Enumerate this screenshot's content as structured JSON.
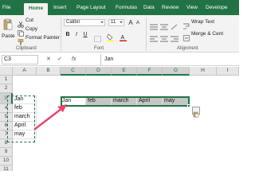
{
  "ribbon_tabs": [
    {
      "label": "File",
      "active": false
    },
    {
      "label": "Home",
      "active": true
    },
    {
      "label": "Insert",
      "active": false
    },
    {
      "label": "Page Layout",
      "active": false
    },
    {
      "label": "Formulas",
      "active": false
    },
    {
      "label": "Data",
      "active": false
    },
    {
      "label": "Review",
      "active": false
    },
    {
      "label": "View",
      "active": false
    },
    {
      "label": "Develope",
      "active": false
    }
  ],
  "clipboard": {
    "paste_label": "Paste",
    "cut_label": "Cut",
    "copy_label": "Copy",
    "format_painter_label": "Format Painter",
    "group_label": "Clipboard"
  },
  "font": {
    "family": "Calibri",
    "size": "11",
    "grow_label": "A",
    "shrink_label": "A",
    "bold_label": "B",
    "italic_label": "I",
    "underline_label": "U",
    "group_label": "Font"
  },
  "alignment": {
    "wrap_text_label": "Wrap Text",
    "merge_center_label": "Merge & Cent",
    "group_label": "Alignment"
  },
  "formula_bar": {
    "name_box": "C3",
    "fx_label": "fx",
    "content": "Jan"
  },
  "sheet": {
    "columns": [
      "A",
      "B",
      "C",
      "D",
      "E",
      "F",
      "G",
      "H",
      "I"
    ],
    "rows": [
      "1",
      "2",
      "3",
      "4",
      "5",
      "6",
      "7",
      "8",
      "9",
      "10",
      "11"
    ],
    "column_a_values": [
      "Jan",
      "feb",
      "march",
      "April",
      "may"
    ],
    "row3_values": [
      "Jan",
      "feb",
      "march",
      "April",
      "may"
    ],
    "selected_cell": "C3",
    "selected_range": "C3:G3",
    "copied_range": "A3:A7"
  },
  "colors": {
    "brand": "#217346",
    "arrow": "#e8456b"
  },
  "icons": [
    "scissors-icon",
    "copy-icon",
    "format-painter-icon",
    "paste-icon",
    "paste-options-icon",
    "fx-icon"
  ]
}
